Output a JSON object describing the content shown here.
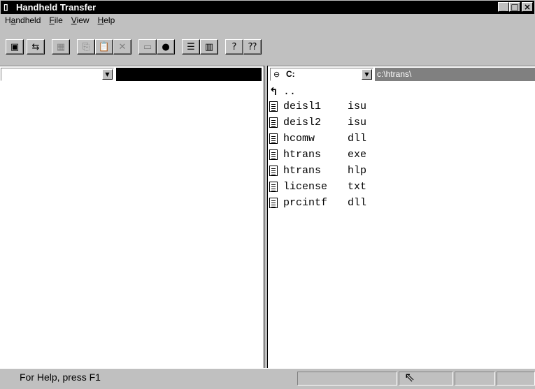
{
  "window": {
    "title": "Handheld Transfer",
    "app_icon": "handheld-app-icon",
    "caption_buttons": [
      "_",
      "□",
      "×"
    ]
  },
  "menu": [
    {
      "label": "Handheld",
      "mnemonic_index": 1
    },
    {
      "label": "File",
      "mnemonic_index": 0
    },
    {
      "label": "View",
      "mnemonic_index": 0
    },
    {
      "label": "Help",
      "mnemonic_index": 0
    }
  ],
  "toolbar": {
    "buttons": [
      {
        "name": "handheld-device-icon",
        "glyph": "▣"
      },
      {
        "name": "transfer-icon",
        "glyph": "⇆"
      },
      {
        "name": "grid-view-icon",
        "glyph": "▦"
      },
      {
        "name": "copy-icon",
        "glyph": "⎘"
      },
      {
        "name": "paste-icon",
        "glyph": "📋"
      },
      {
        "name": "delete-icon",
        "glyph": "✕"
      },
      {
        "name": "drive-icon",
        "glyph": "▭"
      },
      {
        "name": "disk-icon",
        "glyph": "●"
      },
      {
        "name": "list-view-icon",
        "glyph": "☰"
      },
      {
        "name": "details-view-icon",
        "glyph": "▥"
      },
      {
        "name": "about-icon",
        "glyph": "?"
      },
      {
        "name": "context-help-icon",
        "glyph": "⁇"
      }
    ]
  },
  "left_pane": {
    "combo_value": "",
    "path": ""
  },
  "right_pane": {
    "drive": "C:",
    "path": "c:\\htrans\\",
    "up_entry": "..",
    "files": [
      {
        "name": "deisl1",
        "ext": "isu"
      },
      {
        "name": "deisl2",
        "ext": "isu"
      },
      {
        "name": "hcomw",
        "ext": "dll"
      },
      {
        "name": "htrans",
        "ext": "exe"
      },
      {
        "name": "htrans",
        "ext": "hlp"
      },
      {
        "name": "license",
        "ext": "txt"
      },
      {
        "name": "prcintf",
        "ext": "dll"
      }
    ]
  },
  "statusbar": {
    "text": "For Help, press F1"
  }
}
